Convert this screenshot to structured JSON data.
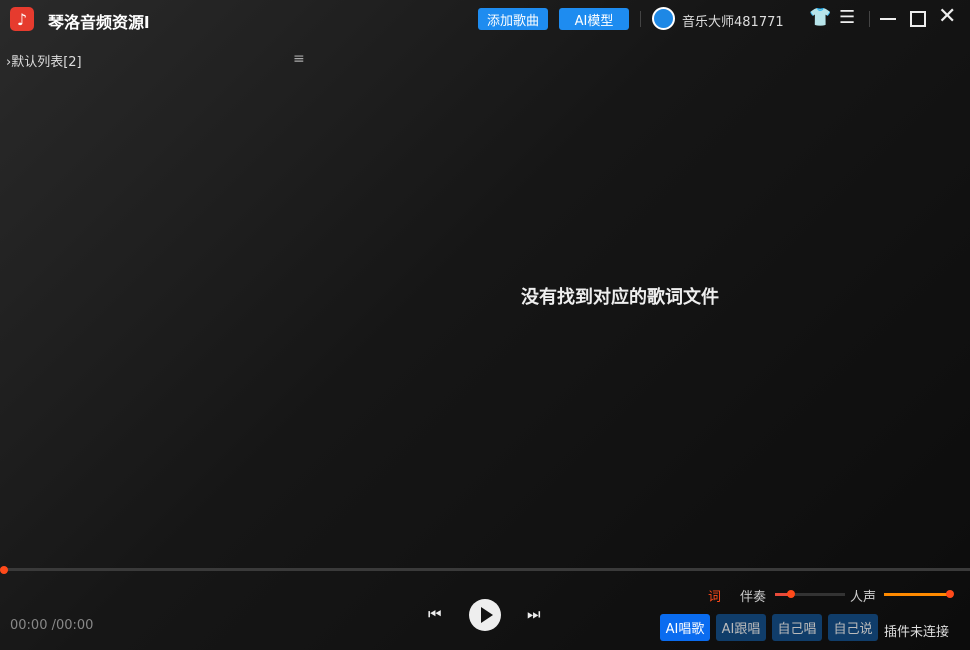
{
  "app": {
    "title": "琴洛音频资源l",
    "logo_icon": "music-note-icon"
  },
  "header": {
    "add_song": "添加歌曲",
    "ai_model": "AI模型",
    "username": "音乐大师481771",
    "accent": "#1e8cf0"
  },
  "sidebar": {
    "playlist": "默认列表[2]"
  },
  "main": {
    "lyric_message": "没有找到对应的歌词文件"
  },
  "player": {
    "current_time": "00:00",
    "total_time": "/00:00",
    "progress": 0,
    "lyric_toggle": "词",
    "accompaniment_label": "伴奏",
    "accompaniment_level": 0.25,
    "vocal_label": "人声",
    "vocal_level": 1.0,
    "modes": [
      "AI唱歌",
      "AI跟唱",
      "自己唱",
      "自己说"
    ],
    "active_mode": "AI唱歌",
    "plugin_status": "插件未连接"
  }
}
